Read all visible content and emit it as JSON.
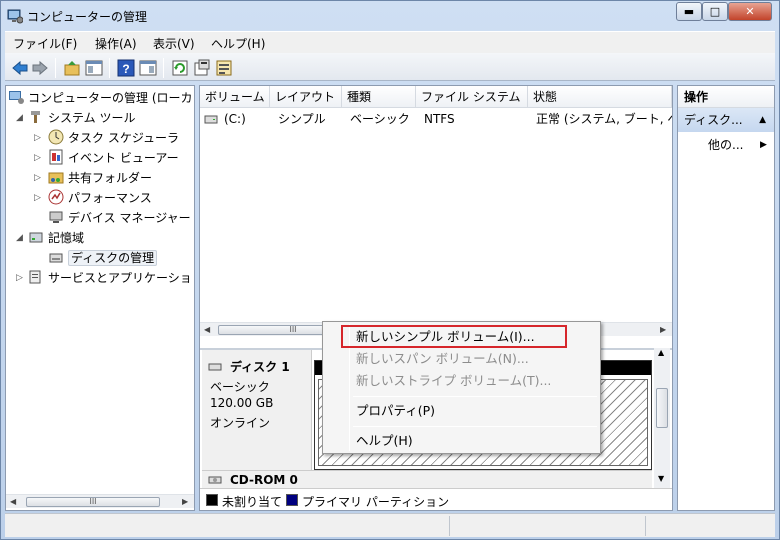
{
  "window": {
    "title": "コンピューターの管理",
    "controls": {
      "minimize": "▬",
      "maximize": "□",
      "close": "✕"
    }
  },
  "menu": [
    "ファイル(F)",
    "操作(A)",
    "表示(V)",
    "ヘルプ(H)"
  ],
  "toolbar": {
    "icons": [
      "back-arrow-icon",
      "forward-arrow-icon",
      "up-folder-icon",
      "show-tree-icon",
      "help-icon",
      "action-pane-icon",
      "refresh-icon",
      "properties-icon",
      "export-icon"
    ]
  },
  "tree": {
    "root": "コンピューターの管理 (ローカ",
    "system_tools": "システム ツール",
    "task_scheduler": "タスク スケジューラ",
    "event_viewer": "イベント ビューアー",
    "shared_folders": "共有フォルダー",
    "performance": "パフォーマンス",
    "device_manager": "デバイス マネージャー",
    "storage": "記憶域",
    "disk_management": "ディスクの管理",
    "services_apps": "サービスとアプリケーショ"
  },
  "volumes": {
    "headers": [
      "ボリューム",
      "レイアウト",
      "種類",
      "ファイル システム",
      "状態"
    ],
    "rows": [
      {
        "volume": "(C:)",
        "layout": "シンプル",
        "type": "ベーシック",
        "fs": "NTFS",
        "status": "正常 (システム, ブート, ペ"
      }
    ]
  },
  "disks": {
    "disk1": {
      "name": "ディスク 1",
      "type": "ベーシック",
      "size": "120.00 GB",
      "status": "オンライン"
    },
    "cdrom": {
      "name": "CD-ROM 0"
    }
  },
  "legend": {
    "unallocated": "未割り当て",
    "primary": "プライマリ パーティション",
    "colors": {
      "unallocated": "#000000",
      "primary": "#00007f"
    }
  },
  "actions": {
    "header": "操作",
    "section": "ディスク...",
    "more": "他の..."
  },
  "scroll": {
    "thumb_label": "III"
  },
  "context_menu": {
    "new_simple": "新しいシンプル ボリューム(I)...",
    "new_spanned": "新しいスパン ボリューム(N)...",
    "new_striped": "新しいストライプ ボリューム(T)...",
    "properties": "プロパティ(P)",
    "help": "ヘルプ(H)",
    "highlight_color": "#d6262b"
  }
}
